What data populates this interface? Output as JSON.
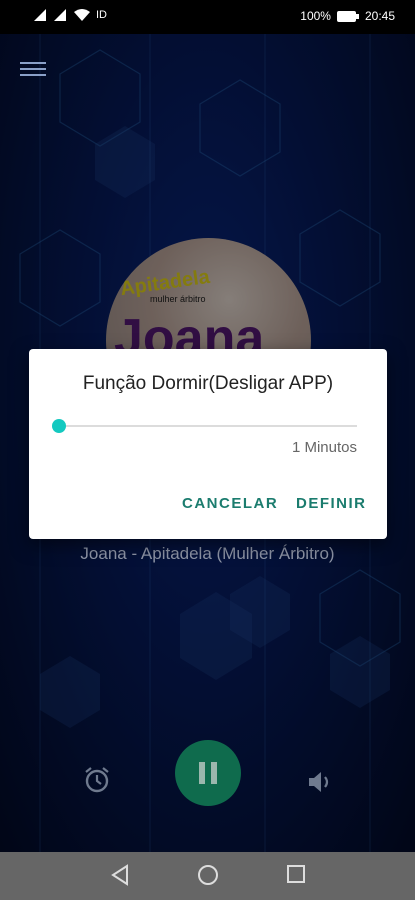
{
  "status_bar": {
    "battery": "100%",
    "time": "20:45"
  },
  "track": {
    "title": "Joana - Apitadela (Mulher Árbitro)"
  },
  "cover": {
    "brand": "Apitadela",
    "subtitle": "mulher árbitro",
    "artist": "Joana"
  },
  "dialog": {
    "title": "Função Dormir(Desligar APP)",
    "slider_value_fraction": 0.0,
    "minutes_label": "1 Minutos",
    "cancel_label": "CANCELAR",
    "define_label": "DEFINIR"
  },
  "icons": [
    "menu-icon",
    "alarm-icon",
    "pause-icon",
    "volume-icon",
    "back-icon",
    "home-icon",
    "recents-icon",
    "signal-icon",
    "wifi-icon",
    "battery-icon"
  ],
  "colors": {
    "accent": "#14c9c0",
    "button_text": "#1b7c6e",
    "play_button": "#0f6b4d",
    "navbar": "#666666"
  }
}
